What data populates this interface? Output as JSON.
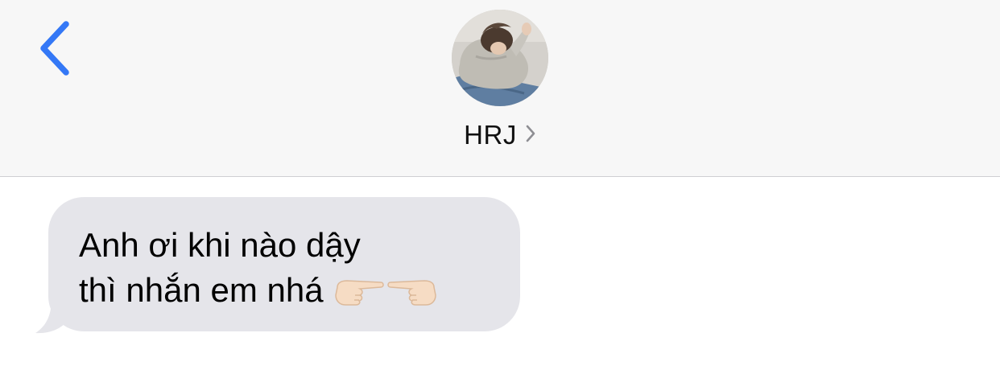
{
  "header": {
    "back_icon": "chevron-left-icon",
    "contact_name": "HRJ",
    "contact_chevron_icon": "chevron-right-icon",
    "avatar_icon": "contact-photo"
  },
  "messages": [
    {
      "direction": "incoming",
      "lines": [
        "Anh ơi khi nào dậy",
        "thì nhắn em nhá"
      ],
      "emojis": [
        "pointing-right-hand-icon",
        "pointing-left-hand-icon"
      ]
    }
  ],
  "colors": {
    "accent": "#3478f6",
    "header_bg": "#f7f7f7",
    "incoming_bubble": "#e5e5ea",
    "divider": "#cfcfd2"
  }
}
